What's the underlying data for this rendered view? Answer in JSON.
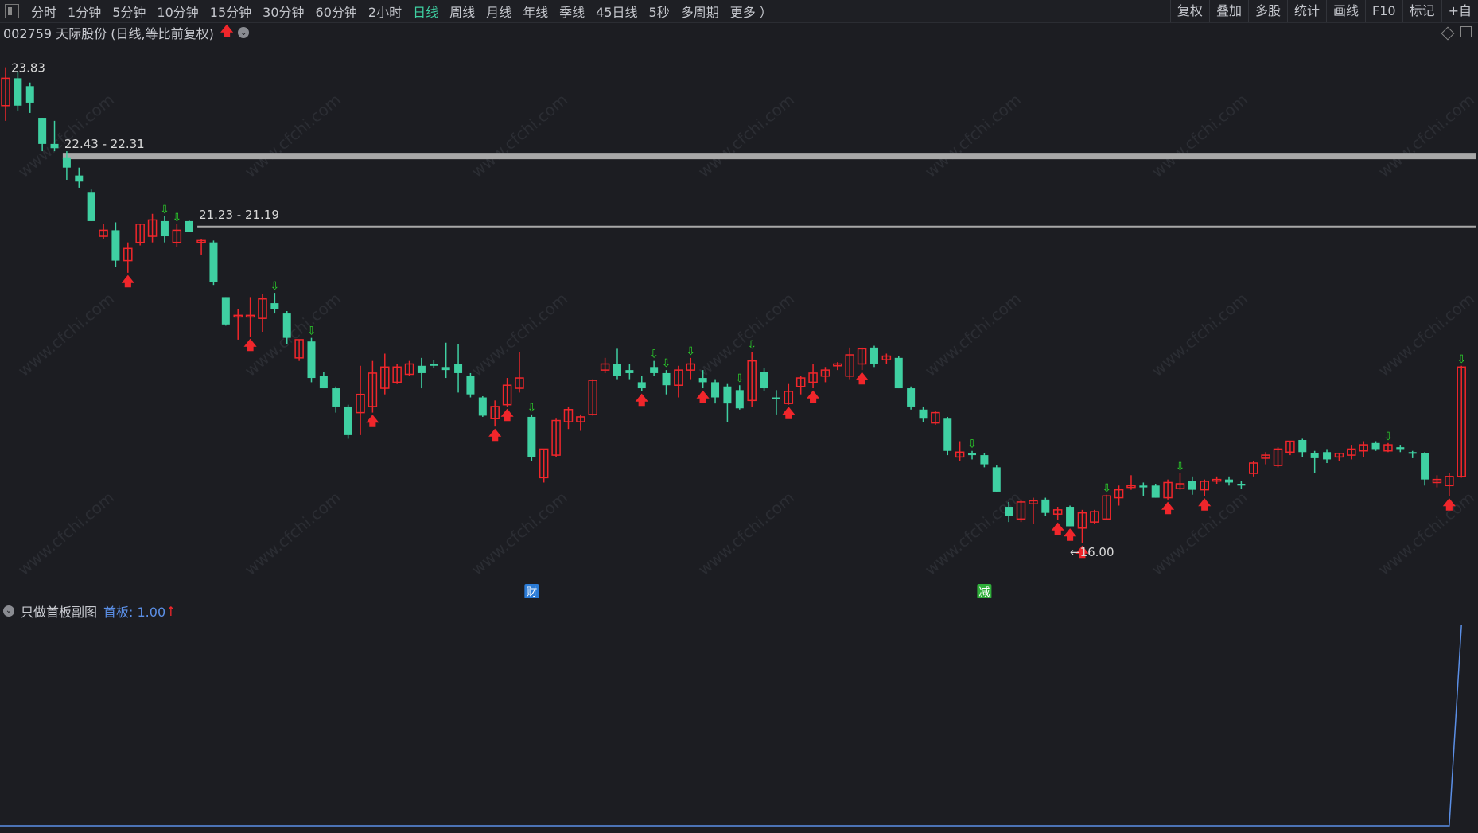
{
  "toolbar": {
    "periods": [
      "分时",
      "1分钟",
      "5分钟",
      "10分钟",
      "15分钟",
      "30分钟",
      "60分钟",
      "2小时",
      "日线",
      "周线",
      "月线",
      "年线",
      "季线",
      "45日线",
      "5秒",
      "多周期",
      "更多 ）"
    ],
    "active_period": "日线",
    "tools": [
      "复权",
      "叠加",
      "多股",
      "统计",
      "画线",
      "F10",
      "标记",
      "+自"
    ]
  },
  "stock": {
    "title": "002759 天际股份 (日线,等比前复权)",
    "status_icon": "up-arrow-red"
  },
  "colors": {
    "up": "#f0262b",
    "down": "#3fd0a2",
    "background": "#1c1d22",
    "indicator_line": "#5b8fe6",
    "signal_up": "#f0262b",
    "signal_down": "#2bd62b",
    "level_line": "#a8a8a8"
  },
  "chart_data": {
    "type": "candlestick",
    "ylim": [
      15.2,
      24.1
    ],
    "max_label": "23.83",
    "min_label": "16.00",
    "levels": [
      {
        "label": "22.43 - 22.31",
        "value": 22.37,
        "start_index": 5,
        "thick": true
      },
      {
        "label": "21.23 - 21.19",
        "value": 21.21,
        "start_index": 16,
        "thick": false
      }
    ],
    "candles": [
      {
        "o": 23.2,
        "h": 23.83,
        "l": 22.95,
        "c": 23.65
      },
      {
        "o": 23.65,
        "h": 23.75,
        "l": 23.12,
        "c": 23.2
      },
      {
        "o": 23.52,
        "h": 23.58,
        "l": 23.08,
        "c": 23.25
      },
      {
        "o": 23.0,
        "h": 23.0,
        "l": 22.45,
        "c": 22.57
      },
      {
        "o": 22.57,
        "h": 22.95,
        "l": 22.45,
        "c": 22.5
      },
      {
        "o": 22.35,
        "h": 22.45,
        "l": 21.98,
        "c": 22.18
      },
      {
        "o": 22.05,
        "h": 22.18,
        "l": 21.85,
        "c": 21.95
      },
      {
        "o": 21.78,
        "h": 21.82,
        "l": 21.3,
        "c": 21.3
      },
      {
        "o": 21.05,
        "h": 21.25,
        "l": 21.0,
        "c": 21.15
      },
      {
        "o": 21.15,
        "h": 21.28,
        "l": 20.55,
        "c": 20.65
      },
      {
        "o": 20.65,
        "h": 20.95,
        "l": 20.45,
        "c": 20.85
      },
      {
        "o": 20.95,
        "h": 21.25,
        "l": 20.9,
        "c": 21.25
      },
      {
        "o": 21.05,
        "h": 21.42,
        "l": 20.95,
        "c": 21.32
      },
      {
        "o": 21.3,
        "h": 21.38,
        "l": 20.95,
        "c": 21.05
      },
      {
        "o": 20.95,
        "h": 21.25,
        "l": 20.88,
        "c": 21.15
      },
      {
        "o": 21.3,
        "h": 21.32,
        "l": 21.12,
        "c": 21.12
      },
      {
        "o": 20.95,
        "h": 21.0,
        "l": 20.75,
        "c": 20.98
      },
      {
        "o": 20.95,
        "h": 20.98,
        "l": 20.25,
        "c": 20.3
      },
      {
        "o": 20.05,
        "h": 20.05,
        "l": 19.58,
        "c": 19.6
      },
      {
        "o": 19.75,
        "h": 19.85,
        "l": 19.35,
        "c": 19.75
      },
      {
        "o": 19.75,
        "h": 20.05,
        "l": 19.4,
        "c": 19.75
      },
      {
        "o": 19.7,
        "h": 20.1,
        "l": 19.48,
        "c": 20.02
      },
      {
        "o": 19.95,
        "h": 20.12,
        "l": 19.78,
        "c": 19.85
      },
      {
        "o": 19.78,
        "h": 19.82,
        "l": 19.28,
        "c": 19.38
      },
      {
        "o": 19.05,
        "h": 19.35,
        "l": 19.0,
        "c": 19.35
      },
      {
        "o": 19.32,
        "h": 19.38,
        "l": 18.65,
        "c": 18.72
      },
      {
        "o": 18.75,
        "h": 18.82,
        "l": 18.55,
        "c": 18.55
      },
      {
        "o": 18.55,
        "h": 18.58,
        "l": 18.15,
        "c": 18.25
      },
      {
        "o": 18.25,
        "h": 18.28,
        "l": 17.72,
        "c": 17.78
      },
      {
        "o": 18.15,
        "h": 18.92,
        "l": 17.78,
        "c": 18.45
      },
      {
        "o": 18.25,
        "h": 19.0,
        "l": 18.15,
        "c": 18.8
      },
      {
        "o": 18.55,
        "h": 19.12,
        "l": 18.45,
        "c": 18.9
      },
      {
        "o": 18.65,
        "h": 18.95,
        "l": 18.62,
        "c": 18.9
      },
      {
        "o": 18.78,
        "h": 19.0,
        "l": 18.75,
        "c": 18.95
      },
      {
        "o": 18.92,
        "h": 19.05,
        "l": 18.55,
        "c": 18.8
      },
      {
        "o": 18.95,
        "h": 19.02,
        "l": 18.88,
        "c": 18.92
      },
      {
        "o": 18.9,
        "h": 19.3,
        "l": 18.72,
        "c": 18.85
      },
      {
        "o": 18.95,
        "h": 19.28,
        "l": 18.48,
        "c": 18.8
      },
      {
        "o": 18.75,
        "h": 18.8,
        "l": 18.4,
        "c": 18.45
      },
      {
        "o": 18.4,
        "h": 18.42,
        "l": 18.08,
        "c": 18.1
      },
      {
        "o": 18.05,
        "h": 18.35,
        "l": 17.92,
        "c": 18.25
      },
      {
        "o": 18.28,
        "h": 18.72,
        "l": 18.25,
        "c": 18.6
      },
      {
        "o": 18.55,
        "h": 19.15,
        "l": 18.48,
        "c": 18.72
      },
      {
        "o": 18.08,
        "h": 18.12,
        "l": 17.35,
        "c": 17.42
      },
      {
        "o": 17.08,
        "h": 17.55,
        "l": 17.0,
        "c": 17.55
      },
      {
        "o": 17.45,
        "h": 18.05,
        "l": 17.42,
        "c": 18.02
      },
      {
        "o": 18.0,
        "h": 18.25,
        "l": 17.88,
        "c": 18.2
      },
      {
        "o": 18.0,
        "h": 18.12,
        "l": 17.85,
        "c": 18.08
      },
      {
        "o": 18.12,
        "h": 18.7,
        "l": 18.1,
        "c": 18.68
      },
      {
        "o": 18.85,
        "h": 19.05,
        "l": 18.8,
        "c": 18.95
      },
      {
        "o": 18.95,
        "h": 19.2,
        "l": 18.7,
        "c": 18.75
      },
      {
        "o": 18.85,
        "h": 18.95,
        "l": 18.7,
        "c": 18.8
      },
      {
        "o": 18.65,
        "h": 18.75,
        "l": 18.5,
        "c": 18.55
      },
      {
        "o": 18.9,
        "h": 19.0,
        "l": 18.75,
        "c": 18.8
      },
      {
        "o": 18.8,
        "h": 18.85,
        "l": 18.45,
        "c": 18.6
      },
      {
        "o": 18.6,
        "h": 18.92,
        "l": 18.4,
        "c": 18.85
      },
      {
        "o": 18.85,
        "h": 19.05,
        "l": 18.7,
        "c": 18.95
      },
      {
        "o": 18.72,
        "h": 18.85,
        "l": 18.55,
        "c": 18.65
      },
      {
        "o": 18.65,
        "h": 18.7,
        "l": 18.3,
        "c": 18.4
      },
      {
        "o": 18.58,
        "h": 18.62,
        "l": 18.0,
        "c": 18.3
      },
      {
        "o": 18.52,
        "h": 18.6,
        "l": 18.2,
        "c": 18.22
      },
      {
        "o": 18.35,
        "h": 19.15,
        "l": 18.25,
        "c": 19.0
      },
      {
        "o": 18.82,
        "h": 18.88,
        "l": 18.5,
        "c": 18.55
      },
      {
        "o": 18.4,
        "h": 18.52,
        "l": 18.12,
        "c": 18.38
      },
      {
        "o": 18.3,
        "h": 18.62,
        "l": 18.28,
        "c": 18.5
      },
      {
        "o": 18.58,
        "h": 18.75,
        "l": 18.45,
        "c": 18.72
      },
      {
        "o": 18.65,
        "h": 18.95,
        "l": 18.55,
        "c": 18.8
      },
      {
        "o": 18.75,
        "h": 18.9,
        "l": 18.65,
        "c": 18.85
      },
      {
        "o": 18.92,
        "h": 18.98,
        "l": 18.85,
        "c": 18.95
      },
      {
        "o": 18.75,
        "h": 19.22,
        "l": 18.7,
        "c": 19.1
      },
      {
        "o": 18.95,
        "h": 19.22,
        "l": 18.85,
        "c": 19.2
      },
      {
        "o": 19.22,
        "h": 19.25,
        "l": 18.9,
        "c": 18.95
      },
      {
        "o": 19.02,
        "h": 19.12,
        "l": 18.95,
        "c": 19.08
      },
      {
        "o": 19.05,
        "h": 19.08,
        "l": 18.55,
        "c": 18.55
      },
      {
        "o": 18.55,
        "h": 18.58,
        "l": 18.2,
        "c": 18.25
      },
      {
        "o": 18.2,
        "h": 18.25,
        "l": 18.0,
        "c": 18.05
      },
      {
        "o": 17.98,
        "h": 18.18,
        "l": 17.95,
        "c": 18.15
      },
      {
        "o": 18.05,
        "h": 18.08,
        "l": 17.45,
        "c": 17.52
      },
      {
        "o": 17.42,
        "h": 17.68,
        "l": 17.35,
        "c": 17.5
      },
      {
        "o": 17.48,
        "h": 17.52,
        "l": 17.38,
        "c": 17.45
      },
      {
        "o": 17.45,
        "h": 17.48,
        "l": 17.25,
        "c": 17.3
      },
      {
        "o": 17.25,
        "h": 17.28,
        "l": 16.85,
        "c": 16.85
      },
      {
        "o": 16.6,
        "h": 16.68,
        "l": 16.35,
        "c": 16.45
      },
      {
        "o": 16.4,
        "h": 16.72,
        "l": 16.35,
        "c": 16.68
      },
      {
        "o": 16.65,
        "h": 16.75,
        "l": 16.32,
        "c": 16.7
      },
      {
        "o": 16.72,
        "h": 16.75,
        "l": 16.45,
        "c": 16.5
      },
      {
        "o": 16.48,
        "h": 16.6,
        "l": 16.38,
        "c": 16.55
      },
      {
        "o": 16.6,
        "h": 16.62,
        "l": 16.28,
        "c": 16.28
      },
      {
        "o": 16.25,
        "h": 16.55,
        "l": 16.0,
        "c": 16.5
      },
      {
        "o": 16.35,
        "h": 16.55,
        "l": 16.32,
        "c": 16.52
      },
      {
        "o": 16.4,
        "h": 16.8,
        "l": 16.38,
        "c": 16.78
      },
      {
        "o": 16.75,
        "h": 16.95,
        "l": 16.62,
        "c": 16.88
      },
      {
        "o": 16.92,
        "h": 17.12,
        "l": 16.88,
        "c": 16.95
      },
      {
        "o": 16.95,
        "h": 17.0,
        "l": 16.78,
        "c": 16.92
      },
      {
        "o": 16.95,
        "h": 16.98,
        "l": 16.75,
        "c": 16.75
      },
      {
        "o": 16.75,
        "h": 17.05,
        "l": 16.72,
        "c": 17.0
      },
      {
        "o": 16.9,
        "h": 17.15,
        "l": 16.88,
        "c": 16.98
      },
      {
        "o": 17.02,
        "h": 17.1,
        "l": 16.8,
        "c": 16.88
      },
      {
        "o": 16.88,
        "h": 17.05,
        "l": 16.78,
        "c": 17.02
      },
      {
        "o": 17.05,
        "h": 17.1,
        "l": 16.98,
        "c": 17.05
      },
      {
        "o": 17.05,
        "h": 17.1,
        "l": 16.95,
        "c": 17.0
      },
      {
        "o": 16.98,
        "h": 17.02,
        "l": 16.9,
        "c": 16.95
      },
      {
        "o": 17.15,
        "h": 17.35,
        "l": 17.1,
        "c": 17.32
      },
      {
        "o": 17.4,
        "h": 17.5,
        "l": 17.3,
        "c": 17.45
      },
      {
        "o": 17.28,
        "h": 17.58,
        "l": 17.25,
        "c": 17.55
      },
      {
        "o": 17.5,
        "h": 17.68,
        "l": 17.45,
        "c": 17.68
      },
      {
        "o": 17.7,
        "h": 17.72,
        "l": 17.42,
        "c": 17.5
      },
      {
        "o": 17.48,
        "h": 17.52,
        "l": 17.15,
        "c": 17.4
      },
      {
        "o": 17.5,
        "h": 17.55,
        "l": 17.32,
        "c": 17.38
      },
      {
        "o": 17.42,
        "h": 17.48,
        "l": 17.35,
        "c": 17.48
      },
      {
        "o": 17.45,
        "h": 17.62,
        "l": 17.38,
        "c": 17.55
      },
      {
        "o": 17.52,
        "h": 17.68,
        "l": 17.42,
        "c": 17.62
      },
      {
        "o": 17.65,
        "h": 17.68,
        "l": 17.52,
        "c": 17.55
      },
      {
        "o": 17.52,
        "h": 17.65,
        "l": 17.5,
        "c": 17.62
      },
      {
        "o": 17.58,
        "h": 17.62,
        "l": 17.5,
        "c": 17.55
      },
      {
        "o": 17.5,
        "h": 17.52,
        "l": 17.4,
        "c": 17.48
      },
      {
        "o": 17.48,
        "h": 17.5,
        "l": 16.95,
        "c": 17.05
      },
      {
        "o": 17.0,
        "h": 17.12,
        "l": 16.92,
        "c": 17.05
      },
      {
        "o": 16.95,
        "h": 17.15,
        "l": 16.78,
        "c": 17.1
      },
      {
        "o": 17.1,
        "h": 18.92,
        "l": 17.08,
        "c": 18.9
      }
    ],
    "signals_up": [
      10,
      20,
      30,
      40,
      41,
      52,
      57,
      64,
      66,
      70,
      86,
      87,
      88,
      95,
      98,
      118
    ],
    "signals_down": [
      13,
      14,
      22,
      25,
      43,
      53,
      54,
      56,
      60,
      61,
      79,
      90,
      96,
      113,
      119
    ],
    "events": [
      {
        "index": 43,
        "label": "财",
        "color": "#2b7bd6"
      },
      {
        "index": 80,
        "label": "减",
        "color": "#2fae3a"
      }
    ]
  },
  "sub_chart": {
    "name": "只做首板副图",
    "value_label": "首板: 1.00",
    "arrow": "↑",
    "values_note": "flat 0 until final bar, then 1.00",
    "series_values": [
      0,
      1.0
    ]
  }
}
